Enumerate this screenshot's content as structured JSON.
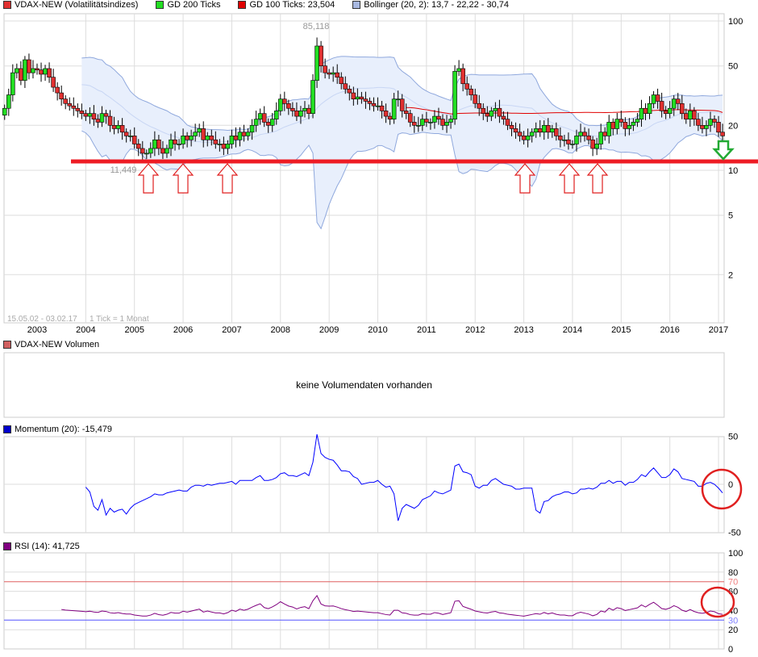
{
  "legend": {
    "main": [
      {
        "label": "VDAX-NEW (Volatilitätsindizes)",
        "color": "#e03030"
      },
      {
        "label": "GD 200 Ticks",
        "color": "#22dd22"
      },
      {
        "label": "GD 100 Ticks: 23,504",
        "color": "#e00000"
      },
      {
        "label": "Bollinger (20, 2): 13,7 - 22,22 - 30,74",
        "color": "#a8b8e0"
      }
    ],
    "volume": {
      "label": "VDAX-NEW Volumen",
      "color": "#d06060"
    },
    "momentum": {
      "label": "Momentum (20): -15,479",
      "color": "#0000cc"
    },
    "rsi": {
      "label": "RSI (14): 41,725",
      "color": "#800080"
    }
  },
  "no_volume_text": "keine Volumendaten vorhanden",
  "range_text": "15.05.02 - 03.02.17",
  "tick_text": "1 Tick = 1 Monat",
  "chart_data": [
    {
      "type": "candlestick",
      "title": "VDAX-NEW",
      "scale": "log",
      "yticks": [
        "100",
        "50",
        "20",
        "10",
        "5",
        "2"
      ],
      "ytick_values": [
        100,
        50,
        20,
        10,
        5,
        2
      ],
      "xticks": [
        "2003",
        "2004",
        "2005",
        "2006",
        "2007",
        "2008",
        "2009",
        "2010",
        "2011",
        "2012",
        "2013",
        "2014",
        "2015",
        "2016",
        "2017"
      ],
      "start": "2002-05",
      "monthly_close": [
        26,
        32,
        45,
        48,
        40,
        55,
        45,
        48,
        47,
        44,
        48,
        42,
        36,
        33,
        30,
        28,
        27,
        26,
        25,
        24,
        23,
        24,
        22,
        21,
        24,
        23,
        20,
        19,
        20,
        18,
        17,
        17,
        15,
        14,
        13,
        13,
        14,
        16,
        14,
        13,
        14,
        16,
        15,
        15,
        17,
        16,
        17,
        18,
        19,
        16,
        17,
        16,
        15,
        15,
        14,
        15,
        17,
        16,
        18,
        17,
        18,
        20,
        22,
        24,
        21,
        20,
        22,
        25,
        30,
        28,
        26,
        25,
        23,
        25,
        26,
        24,
        40,
        68,
        50,
        45,
        44,
        45,
        42,
        38,
        35,
        33,
        30,
        31,
        30,
        29,
        28,
        27,
        27,
        25,
        23,
        22,
        30,
        30,
        25,
        24,
        21,
        20,
        20,
        22,
        21,
        21,
        23,
        22,
        20,
        21,
        22,
        46,
        48,
        38,
        35,
        32,
        28,
        26,
        24,
        23,
        25,
        26,
        23,
        22,
        20,
        19,
        18,
        17,
        16,
        17,
        18,
        19,
        18,
        20,
        18,
        19,
        17,
        16,
        16,
        15,
        15,
        17,
        18,
        17,
        16,
        14,
        15,
        18,
        17,
        21,
        19,
        22,
        21,
        19,
        20,
        21,
        22,
        26,
        24,
        28,
        32,
        29,
        25,
        24,
        26,
        30,
        28,
        24,
        22,
        25,
        22,
        20,
        19,
        20,
        22,
        21,
        18,
        17
      ],
      "annotations": {
        "high_label": "85,118",
        "high_value": 85.118,
        "low_label": "11,449",
        "low_value": 11.449,
        "support_line": 11.449
      },
      "colors": {
        "up": "#22dd22",
        "down": "#e03030",
        "gd100": "#e00000",
        "bollinger": "#8fa8dd",
        "support": "#ee1c24"
      }
    },
    {
      "type": "line",
      "title": "Momentum (20)",
      "yticks": [
        "50",
        "0",
        "-50"
      ],
      "ylim": [
        -50,
        50
      ],
      "color": "#0000ff"
    },
    {
      "type": "line",
      "title": "RSI (14)",
      "yticks": [
        "100",
        "80",
        "70",
        "60",
        "40",
        "30",
        "20",
        "0"
      ],
      "ylim": [
        0,
        100
      ],
      "levels": [
        70,
        30
      ],
      "color": "#800080"
    }
  ]
}
